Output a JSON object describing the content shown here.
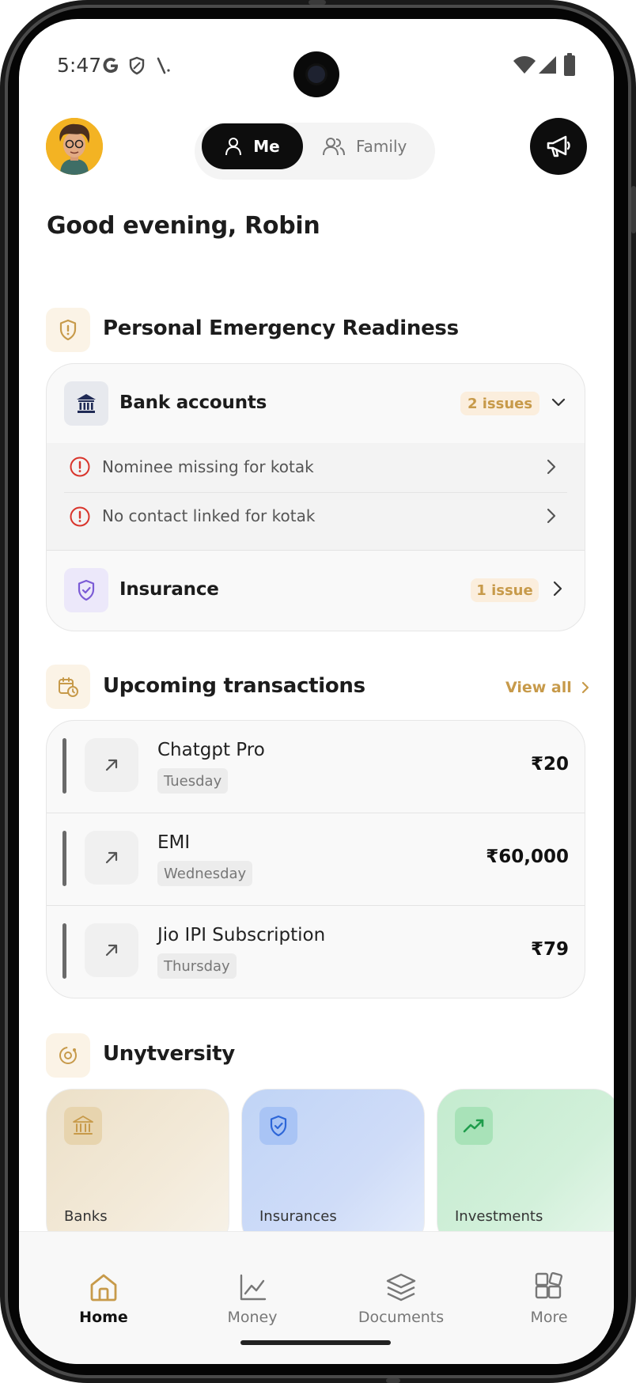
{
  "status_bar": {
    "time": "5:47",
    "left_icons": [
      "google-g-icon",
      "shield-icon",
      "signal-slash-icon"
    ],
    "right_icons": [
      "wifi-icon",
      "cell-signal-icon",
      "battery-icon"
    ]
  },
  "header": {
    "segment": {
      "me": "Me",
      "family": "Family",
      "selected": "Me"
    },
    "greeting": "Good evening, Robin"
  },
  "readiness": {
    "title": "Personal Emergency Readiness",
    "bank": {
      "label": "Bank accounts",
      "badge": "2 issues",
      "issues": [
        "Nominee missing for kotak",
        "No contact linked for kotak"
      ]
    },
    "insurance": {
      "label": "Insurance",
      "badge": "1 issue"
    }
  },
  "transactions": {
    "title": "Upcoming transactions",
    "view_all": "View all",
    "items": [
      {
        "name": "Chatgpt Pro",
        "day": "Tuesday",
        "amount": "₹20"
      },
      {
        "name": "EMI",
        "day": "Wednesday",
        "amount": "₹60,000"
      },
      {
        "name": "Jio IPI Subscription",
        "day": "Thursday",
        "amount": "₹79"
      }
    ]
  },
  "unytversity": {
    "title": "Unytversity",
    "tiles": [
      {
        "label": "Banks",
        "icon": "bank-icon"
      },
      {
        "label": "Insurances",
        "icon": "shield-check-icon"
      },
      {
        "label": "Investments",
        "icon": "trending-up-icon"
      }
    ]
  },
  "bottom_nav": {
    "items": [
      {
        "label": "Home",
        "icon": "home-icon"
      },
      {
        "label": "Money",
        "icon": "chart-line-icon"
      },
      {
        "label": "Documents",
        "icon": "layers-icon"
      },
      {
        "label": "More",
        "icon": "grid-plus-icon"
      }
    ],
    "active": "Home"
  },
  "colors": {
    "accent_gold": "#c79a4a",
    "error_red": "#d9342b",
    "dark": "#0d0d0d"
  }
}
